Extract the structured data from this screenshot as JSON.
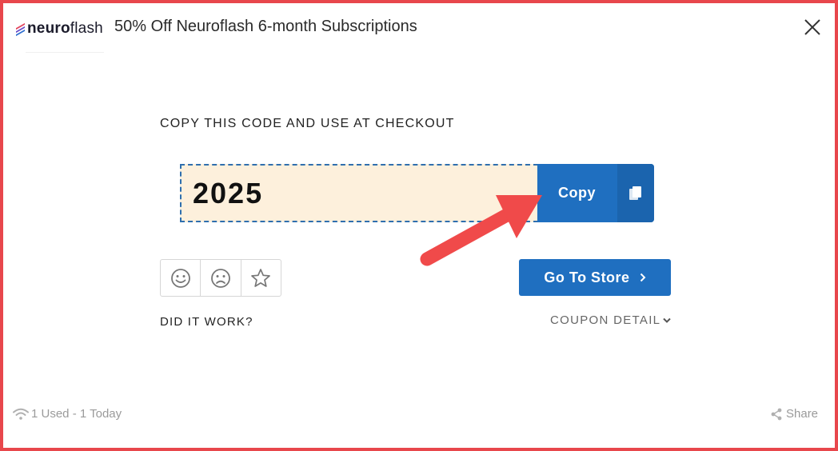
{
  "header": {
    "logo_text_bold": "neuro",
    "logo_text_rest": "flash",
    "title": "50% Off Neuroflash 6-month Subscriptions"
  },
  "coupon": {
    "instruction": "COPY THIS CODE AND USE AT CHECKOUT",
    "code": "2025",
    "copy_label": "Copy",
    "go_to_store_label": "Go To Store",
    "did_it_work": "DID IT WORK?",
    "detail_label": "COUPON DETAIL"
  },
  "footer": {
    "usage": "1 Used - 1 Today",
    "share_label": "Share"
  },
  "icons": {
    "close": "close-icon",
    "copy": "copy-icon",
    "smile": "smile-icon",
    "frown": "frown-icon",
    "star": "star-icon",
    "chevron_right": "chevron-right-icon",
    "chevron_down": "chevron-down-icon",
    "wifi": "wifi-icon",
    "share": "share-icon",
    "arrow": "red-arrow-annotation"
  },
  "colors": {
    "frame": "#e8474c",
    "primary": "#1f6fc0",
    "code_bg": "#fdf0dc",
    "code_border": "#2f6fae",
    "annotation_arrow": "#f04a4a"
  }
}
